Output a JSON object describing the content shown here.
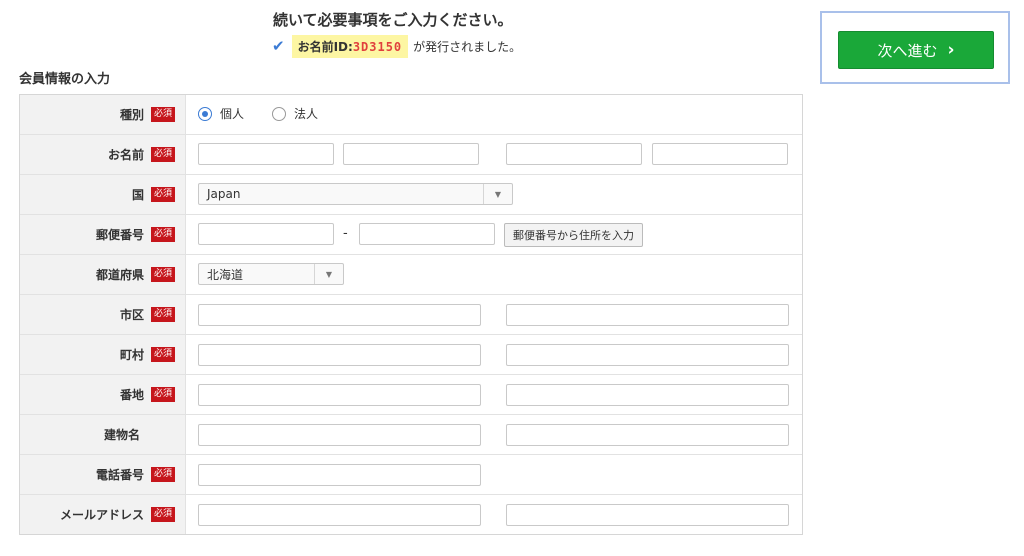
{
  "header": {
    "title": "続いて必要事項をご入力ください。",
    "id_label": "お名前ID:",
    "id_value": "3D3150",
    "id_suffix": "が発行されました。",
    "check_icon": "✔"
  },
  "next_button": {
    "label": "次へ進む",
    "chevron": "›"
  },
  "section_title": "会員情報の入力",
  "required_badge": "必須",
  "rows": {
    "type": {
      "label": "種別",
      "option_personal": "個人",
      "option_corporate": "法人"
    },
    "name": {
      "label": "お名前"
    },
    "country": {
      "label": "国",
      "value": "Japan"
    },
    "postal": {
      "label": "郵便番号",
      "dash": "-",
      "lookup_button": "郵便番号から住所を入力"
    },
    "prefecture": {
      "label": "都道府県",
      "value": "北海道"
    },
    "city": {
      "label": "市区"
    },
    "town": {
      "label": "町村"
    },
    "street": {
      "label": "番地"
    },
    "building": {
      "label": "建物名"
    },
    "phone": {
      "label": "電話番号"
    },
    "email": {
      "label": "メールアドレス"
    }
  },
  "colors": {
    "accent": "#1aa839",
    "required": "#c6161c",
    "highlight": "#fdf6a3",
    "radio": "#3b7bd4"
  }
}
